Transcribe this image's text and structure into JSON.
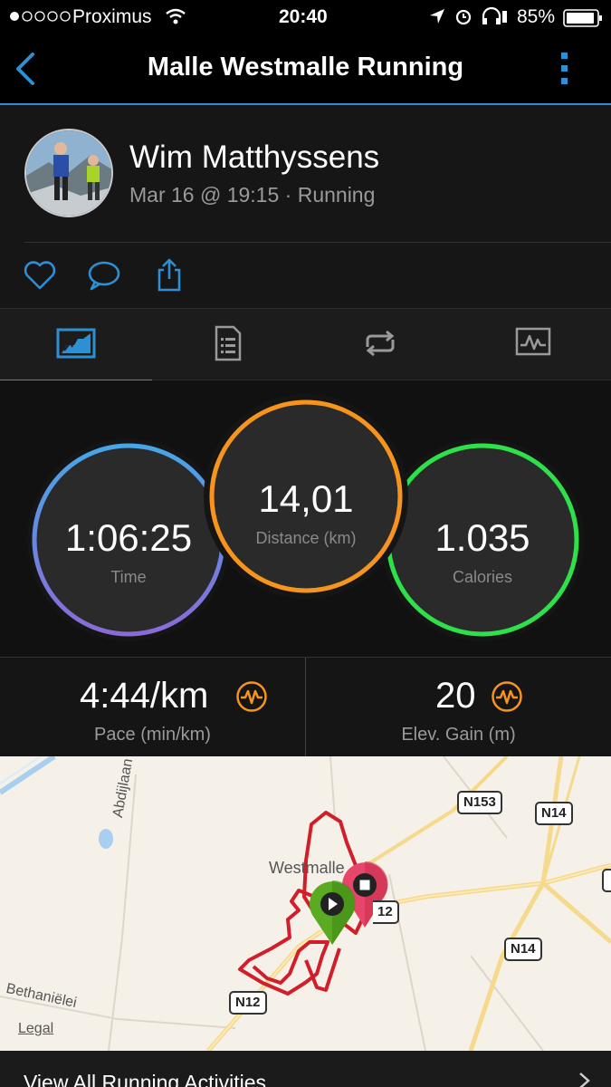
{
  "status_bar": {
    "carrier": "Proximus",
    "time": "20:40",
    "battery": "85%"
  },
  "nav": {
    "title": "Malle Westmalle Running",
    "back_icon": "chevron-left-icon",
    "menu_icon": "vertical-dots-icon"
  },
  "profile": {
    "name": "Wim Matthyssens",
    "subtitle": "Mar 16 @ 19:15 · Running"
  },
  "social": {
    "like_icon": "heart-icon",
    "comment_icon": "comment-icon",
    "share_icon": "share-icon"
  },
  "tabs": [
    {
      "name": "overview",
      "icon": "overview-icon",
      "active": true
    },
    {
      "name": "details",
      "icon": "document-icon",
      "active": false
    },
    {
      "name": "laps",
      "icon": "laps-icon",
      "active": false
    },
    {
      "name": "charts",
      "icon": "chart-icon",
      "active": false
    }
  ],
  "stats": {
    "time": {
      "value": "1:06:25",
      "label": "Time"
    },
    "distance": {
      "value": "14,01",
      "label": "Distance (km)"
    },
    "calories": {
      "value": "1.035",
      "label": "Calories"
    }
  },
  "metrics": {
    "pace": {
      "value": "4:44/km",
      "label": "Pace (min/km)"
    },
    "elevation": {
      "value": "20",
      "label": "Elev. Gain (m)"
    }
  },
  "map": {
    "labels": {
      "town": "Westmalle",
      "abdijlaan": "Abdijlaan",
      "bethanielei": "Bethaniëlei",
      "legal": "Legal"
    },
    "roads": {
      "n153": "N153",
      "n14_top": "N14",
      "n14_mid": "N14",
      "n12_left": "N12",
      "n12_right": "12"
    }
  },
  "footer": {
    "label": "View All Running Activities"
  },
  "colors": {
    "accent_blue": "#2d8fd4",
    "time_ring": "#4a9ee0",
    "distance_ring": "#f7941d",
    "calories_ring": "#2ee04a",
    "route": "#d21e2b",
    "start_pin": "#5aaa24",
    "end_pin": "#e8456b"
  }
}
